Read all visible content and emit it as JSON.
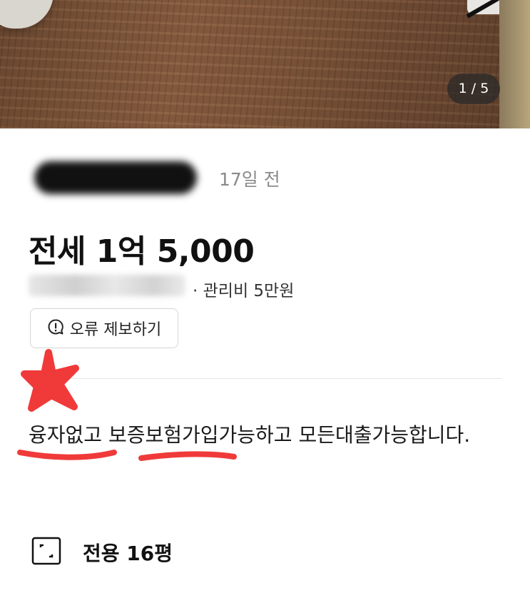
{
  "photo": {
    "counter": "1 / 5"
  },
  "listing": {
    "time_ago": "17일 전",
    "price": "전세 1억 5,000",
    "fee": "· 관리비 5만원",
    "report_button": "오류 제보하기",
    "description": "융자없고 보증보험가입가능하고 모든대출가능합니다.",
    "area": "전용 16평"
  },
  "icons": {
    "report": "alert-bubble-icon",
    "area": "floor-area-icon"
  },
  "colors": {
    "annotation": "#f03a3a",
    "muted_text": "#8a8a8a"
  }
}
